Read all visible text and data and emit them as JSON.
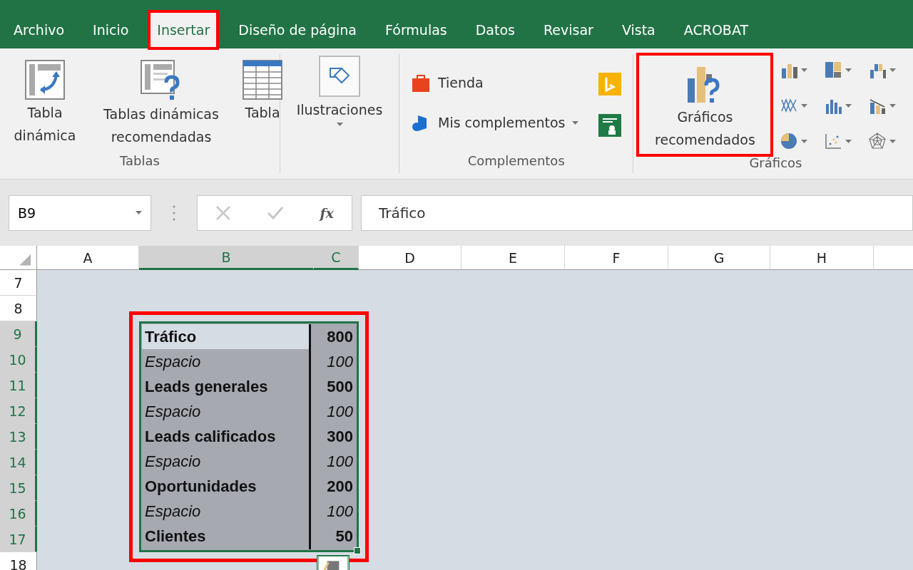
{
  "tabs": [
    {
      "label": "Archivo",
      "selected": false,
      "highlighted": false
    },
    {
      "label": "Inicio",
      "selected": false,
      "highlighted": false
    },
    {
      "label": "Insertar",
      "selected": true,
      "highlighted": true
    },
    {
      "label": "Diseño de página",
      "selected": false,
      "highlighted": false
    },
    {
      "label": "Fórmulas",
      "selected": false,
      "highlighted": false
    },
    {
      "label": "Datos",
      "selected": false,
      "highlighted": false
    },
    {
      "label": "Revisar",
      "selected": false,
      "highlighted": false
    },
    {
      "label": "Vista",
      "selected": false,
      "highlighted": false
    },
    {
      "label": "ACROBAT",
      "selected": false,
      "highlighted": false
    }
  ],
  "ribbon": {
    "groups": [
      {
        "label": "Tablas",
        "kind": "tables",
        "buttons": [
          {
            "label": "Tabla dinámica",
            "highlighted": false
          },
          {
            "label": "Tablas dinámicas recomendadas",
            "highlighted": false
          },
          {
            "label": "Tabla",
            "highlighted": false
          }
        ]
      },
      {
        "kind": "illustrations",
        "buttons": [
          {
            "label": "Ilustraciones",
            "highlighted": false
          }
        ]
      },
      {
        "label": "Complementos",
        "kind": "addins",
        "buttons": [
          {
            "label": "Tienda",
            "highlighted": false
          },
          {
            "label": "Mis complementos",
            "highlighted": false
          }
        ]
      },
      {
        "label": "Gráficos",
        "kind": "charts",
        "buttons": [
          {
            "label": "Gráficos recomendados",
            "highlighted": true
          }
        ]
      }
    ]
  },
  "formula_bar": {
    "name_box": "B9",
    "fx": "fx",
    "value": "Tráfico"
  },
  "columns": [
    {
      "label": "A",
      "selected": false
    },
    {
      "label": "B",
      "selected": true
    },
    {
      "label": "C",
      "selected": true
    },
    {
      "label": "D",
      "selected": false
    },
    {
      "label": "E",
      "selected": false
    },
    {
      "label": "F",
      "selected": false
    },
    {
      "label": "G",
      "selected": false
    },
    {
      "label": "H",
      "selected": false
    }
  ],
  "rows": [
    {
      "label": "7",
      "selected": false
    },
    {
      "label": "8",
      "selected": false
    },
    {
      "label": "9",
      "selected": true
    },
    {
      "label": "10",
      "selected": true
    },
    {
      "label": "11",
      "selected": true
    },
    {
      "label": "12",
      "selected": true
    },
    {
      "label": "13",
      "selected": true
    },
    {
      "label": "14",
      "selected": true
    },
    {
      "label": "15",
      "selected": true
    },
    {
      "label": "16",
      "selected": true
    },
    {
      "label": "17",
      "selected": true
    },
    {
      "label": "18",
      "selected": false
    }
  ],
  "range": {
    "highlighted": true,
    "cells": [
      {
        "kind": "bold",
        "label": "Tráfico",
        "value": "800",
        "active": true
      },
      {
        "kind": "italic",
        "label": "Espacio",
        "value": "100",
        "active": false
      },
      {
        "kind": "bold",
        "label": "Leads generales",
        "value": "500",
        "active": false
      },
      {
        "kind": "italic",
        "label": "Espacio",
        "value": "100",
        "active": false
      },
      {
        "kind": "bold",
        "label": "Leads calificados",
        "value": "300",
        "active": false
      },
      {
        "kind": "italic",
        "label": "Espacio",
        "value": "100",
        "active": false
      },
      {
        "kind": "bold",
        "label": "Oportunidades",
        "value": "200",
        "active": false
      },
      {
        "kind": "italic",
        "label": "Espacio",
        "value": "100",
        "active": false
      },
      {
        "kind": "bold",
        "label": "Clientes",
        "value": "50",
        "active": false
      }
    ]
  }
}
